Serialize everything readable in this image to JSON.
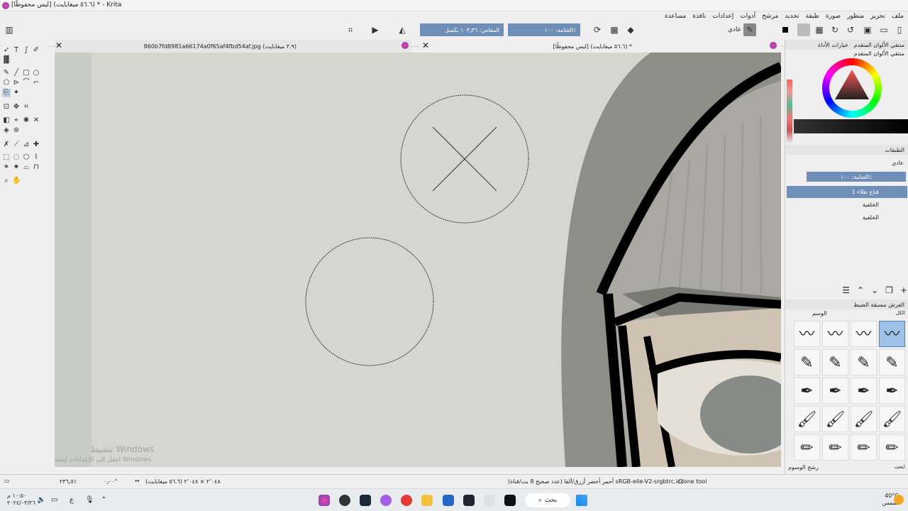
{
  "window": {
    "title": "[ليس محفوظًا] (٥٦.٦ ميغابايت) * - Krita"
  },
  "menu": [
    "ملف",
    "تحرير",
    "منظور",
    "صورة",
    "طبقة",
    "تحديد",
    "مرشح",
    "أدوات",
    "إعدادات",
    "نافذة",
    "مساعدة"
  ],
  "toolbar": {
    "blend_mode": "عادي",
    "opacity_label": "العتامة: ١٠٠٪",
    "scale_label": "المقاس: ١٠٣٫٣٦ بكسل"
  },
  "tabs": [
    {
      "title": "860b7fd8981a66174a0f65af4fbd54af.jpg (٣.٩ ميغابايت)"
    },
    {
      "title": "[ليس محفوظًا] (٥٦.٦ ميغابايت) *"
    }
  ],
  "dockers": {
    "tab_active": "منتقي الألوان المتقدم",
    "tab_other": "خيارات الأداة",
    "color_title": "منتقي الألوان المتقدم",
    "layers_title": "الطبقات",
    "layers_blend": "عادي",
    "layers_opacity": "العتامة: ١٠٠٪",
    "layers": [
      {
        "name": "قناع طلاء 1",
        "selected": true
      },
      {
        "name": "الخلفية",
        "selected": false
      },
      {
        "name": "الخلفية",
        "selected": false
      }
    ],
    "presets_title": "الفرش مسبقة الضبط",
    "presets_tag_label": "الوسم",
    "presets_filter_label": "الكل",
    "presets_footer": "رشح الوسوم",
    "presets_search_label": "ابحث"
  },
  "statusbar": {
    "tool": "Clone tool",
    "color_profile": "أحمر أخضر أزرق/ألفا (عدد صحيح 8 بت/قناة)  sRGB-elle-V2-srgbtrc.icc",
    "image_info": "٢٬٠٤٨ × ٢٬٠٤٨ (٥٦.٦ ميغابايت)",
    "angle": "٠٫٠٠°",
    "zoom": "٢٣٦٫٧٪"
  },
  "watermark": {
    "line1": "تنشيط Windows",
    "line2": "انتقل إلى الإعدادات لتنشيط Windows."
  },
  "taskbar": {
    "search_label": "بحث",
    "time": "١٠:٥٠ م",
    "date": "٢٠٢٤/٠٣/٢٦",
    "weather_temp": "40°C",
    "weather_desc": "مشمس",
    "lang": "ع"
  },
  "colors": {
    "accent": "#6f8fb8",
    "canvas": "#d6d6d0"
  }
}
